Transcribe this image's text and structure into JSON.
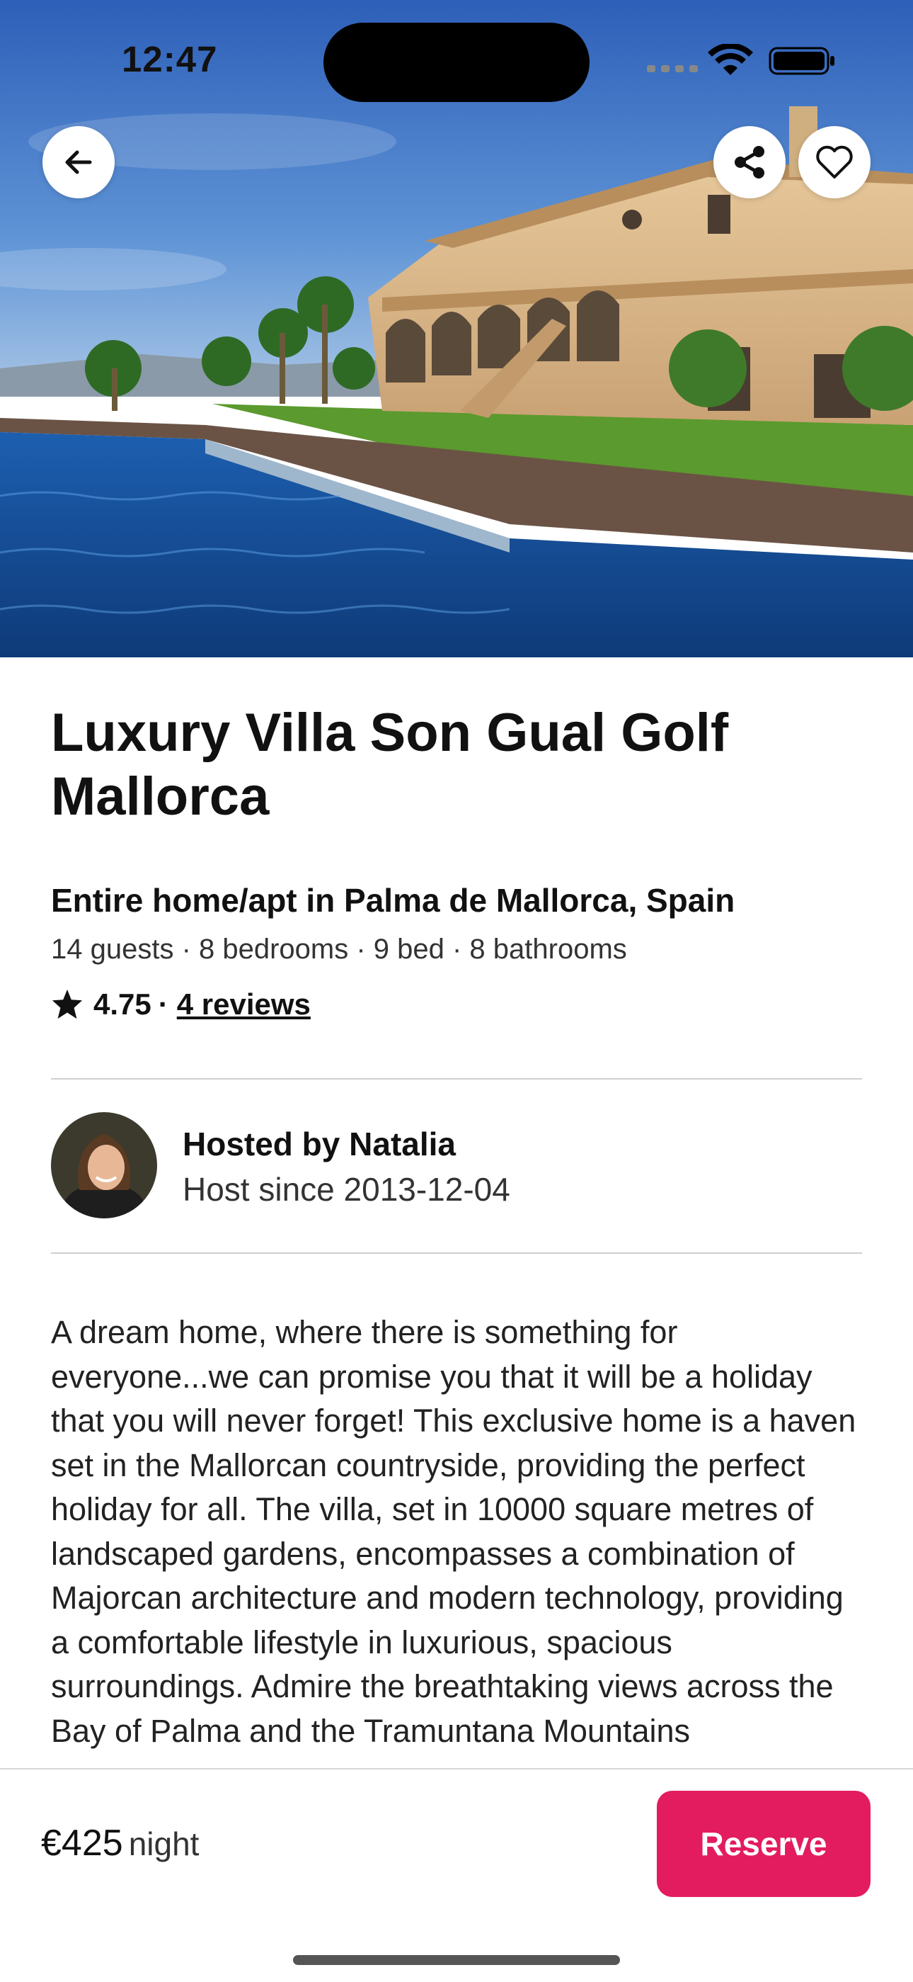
{
  "status_bar": {
    "time": "12:47"
  },
  "listing": {
    "title": "Luxury Villa Son Gual Golf Mallorca",
    "subtitle": "Entire home/apt in Palma de Mallorca, Spain",
    "specs": "14 guests · 8 bedrooms · 9 bed · 8 bathrooms",
    "rating": "4.75",
    "rating_separator": "·",
    "reviews": "4 reviews"
  },
  "host": {
    "name": "Hosted by Natalia",
    "since": "Host since 2013-12-04"
  },
  "description": "A dream home, where there is something for everyone...we can promise you that it will be a holiday that you will never forget! This exclusive home is a haven set in the Mallorcan countryside, providing the perfect holiday for all. The villa, set in 10000 square metres of landscaped gardens, encompasses a combination of Majorcan architecture and modern technology, providing a comfortable lifestyle in luxurious, spacious surroundings. Admire the breathtaking views across the Bay of Palma and the Tramuntana Mountains",
  "footer": {
    "price": "€425",
    "price_unit": "night",
    "reserve_label": "Reserve"
  },
  "icons": {
    "back": "arrow-left-icon",
    "share": "share-icon",
    "favorite": "heart-icon",
    "star": "star-icon"
  },
  "colors": {
    "reserve_button": "#e31c5f",
    "text": "#222222"
  }
}
